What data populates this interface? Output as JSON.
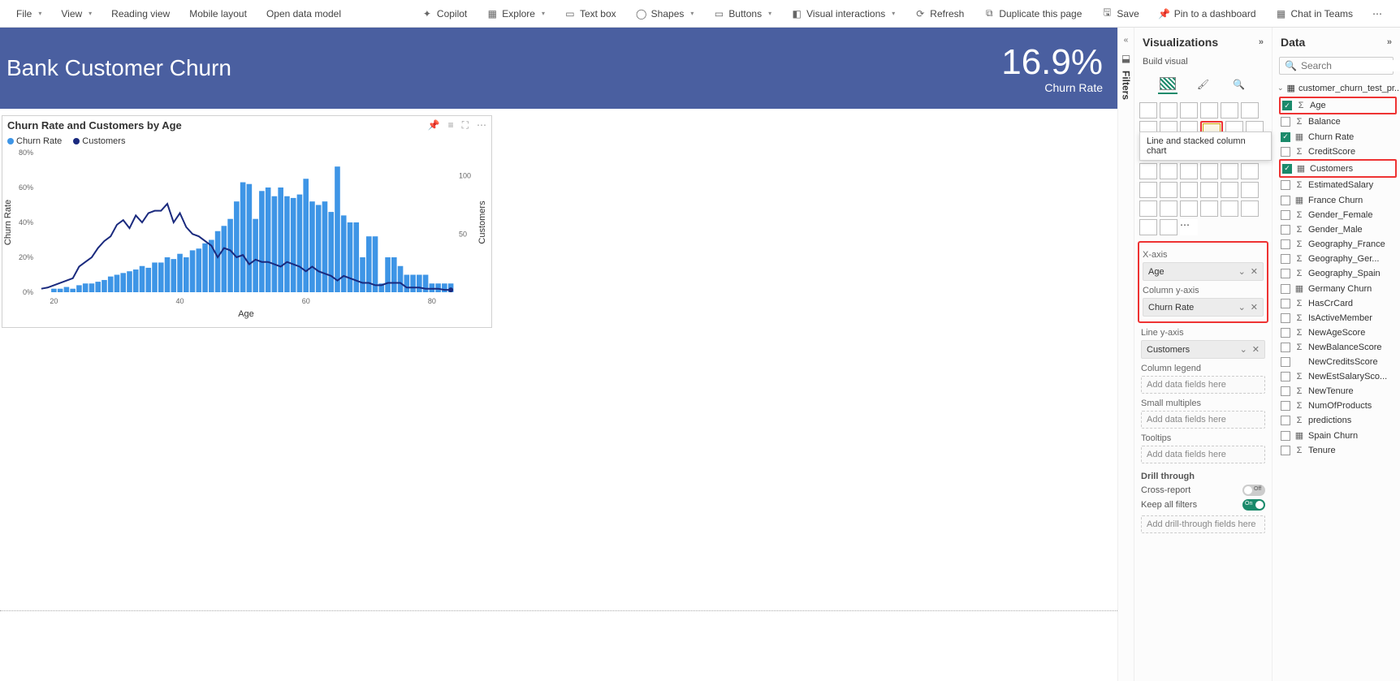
{
  "toolbar": {
    "file": "File",
    "view": "View",
    "reading_view": "Reading view",
    "mobile_layout": "Mobile layout",
    "open_data_model": "Open data model",
    "copilot": "Copilot",
    "explore": "Explore",
    "text_box": "Text box",
    "shapes": "Shapes",
    "buttons": "Buttons",
    "visual_interactions": "Visual interactions",
    "refresh": "Refresh",
    "duplicate": "Duplicate this page",
    "save": "Save",
    "pin": "Pin to a dashboard",
    "chat_teams": "Chat in Teams"
  },
  "banner": {
    "title": "Bank Customer Churn",
    "kpi_value": "16.9%",
    "kpi_label": "Churn Rate"
  },
  "visual": {
    "title": "Churn Rate and Customers by Age",
    "legend_a": "Churn Rate",
    "legend_b": "Customers",
    "xlabel": "Age",
    "ylabel_left": "Churn Rate",
    "ylabel_right": "Customers"
  },
  "filters": {
    "label": "Filters"
  },
  "viz_pane": {
    "title": "Visualizations",
    "subtitle": "Build visual",
    "tooltip": "Line and stacked column chart",
    "wells": {
      "xaxis": "X-axis",
      "xaxis_val": "Age",
      "col_y": "Column y-axis",
      "col_y_val": "Churn Rate",
      "line_y": "Line y-axis",
      "line_y_val": "Customers",
      "col_legend": "Column legend",
      "placeholder": "Add data fields here",
      "small_mult": "Small multiples",
      "tooltips": "Tooltips",
      "drill": "Drill through",
      "cross": "Cross-report",
      "keep_filters": "Keep all filters",
      "off": "Off",
      "on": "On",
      "add_drill": "Add drill-through fields here"
    }
  },
  "data_pane": {
    "title": "Data",
    "search_placeholder": "Search",
    "table": "customer_churn_test_pr...",
    "fields": [
      {
        "name": "Age",
        "checked": true,
        "icon": "Σ",
        "red": true
      },
      {
        "name": "Balance",
        "checked": false,
        "icon": "Σ"
      },
      {
        "name": "Churn Rate",
        "checked": true,
        "icon": "▦"
      },
      {
        "name": "CreditScore",
        "checked": false,
        "icon": "Σ"
      },
      {
        "name": "Customers",
        "checked": true,
        "icon": "▦",
        "red": true
      },
      {
        "name": "EstimatedSalary",
        "checked": false,
        "icon": "Σ"
      },
      {
        "name": "France Churn",
        "checked": false,
        "icon": "▦"
      },
      {
        "name": "Gender_Female",
        "checked": false,
        "icon": "Σ"
      },
      {
        "name": "Gender_Male",
        "checked": false,
        "icon": "Σ"
      },
      {
        "name": "Geography_France",
        "checked": false,
        "icon": "Σ"
      },
      {
        "name": "Geography_Ger...",
        "checked": false,
        "icon": "Σ"
      },
      {
        "name": "Geography_Spain",
        "checked": false,
        "icon": "Σ"
      },
      {
        "name": "Germany Churn",
        "checked": false,
        "icon": "▦"
      },
      {
        "name": "HasCrCard",
        "checked": false,
        "icon": "Σ"
      },
      {
        "name": "IsActiveMember",
        "checked": false,
        "icon": "Σ"
      },
      {
        "name": "NewAgeScore",
        "checked": false,
        "icon": "Σ"
      },
      {
        "name": "NewBalanceScore",
        "checked": false,
        "icon": "Σ"
      },
      {
        "name": "NewCreditsScore",
        "checked": false,
        "icon": ""
      },
      {
        "name": "NewEstSalarySco...",
        "checked": false,
        "icon": "Σ"
      },
      {
        "name": "NewTenure",
        "checked": false,
        "icon": "Σ"
      },
      {
        "name": "NumOfProducts",
        "checked": false,
        "icon": "Σ"
      },
      {
        "name": "predictions",
        "checked": false,
        "icon": "Σ"
      },
      {
        "name": "Spain Churn",
        "checked": false,
        "icon": "▦"
      },
      {
        "name": "Tenure",
        "checked": false,
        "icon": "Σ"
      }
    ]
  },
  "chart_data": {
    "type": "line_stacked_column",
    "xlabel": "Age",
    "ylabel_left": "Churn Rate",
    "ylabel_right": "Customers",
    "x_ticks": [
      20,
      40,
      60,
      80
    ],
    "y_left_ticks": [
      "0%",
      "20%",
      "40%",
      "60%",
      "80%"
    ],
    "y_right_ticks": [
      50,
      100
    ],
    "ages": [
      18,
      19,
      20,
      21,
      22,
      23,
      24,
      25,
      26,
      27,
      28,
      29,
      30,
      31,
      32,
      33,
      34,
      35,
      36,
      37,
      38,
      39,
      40,
      41,
      42,
      43,
      44,
      45,
      46,
      47,
      48,
      49,
      50,
      51,
      52,
      53,
      54,
      55,
      56,
      57,
      58,
      59,
      60,
      61,
      62,
      63,
      64,
      65,
      66,
      67,
      68,
      69,
      70,
      71,
      72,
      73,
      74,
      75,
      76,
      77,
      78,
      79,
      80,
      81,
      82,
      83
    ],
    "columns_churn_rate_pct": [
      0,
      0,
      2,
      2,
      3,
      2,
      4,
      5,
      5,
      6,
      7,
      9,
      10,
      11,
      12,
      13,
      15,
      14,
      17,
      17,
      20,
      19,
      22,
      20,
      24,
      25,
      28,
      30,
      35,
      38,
      42,
      52,
      63,
      62,
      42,
      58,
      60,
      55,
      60,
      55,
      54,
      56,
      65,
      52,
      50,
      52,
      46,
      72,
      44,
      40,
      40,
      20,
      32,
      32,
      5,
      20,
      20,
      15,
      10,
      10,
      10,
      10,
      5,
      5,
      5,
      5
    ],
    "line_customers": [
      3,
      4,
      6,
      8,
      10,
      12,
      22,
      26,
      30,
      38,
      44,
      48,
      58,
      62,
      55,
      66,
      60,
      68,
      70,
      70,
      76,
      60,
      68,
      56,
      50,
      48,
      44,
      40,
      30,
      38,
      36,
      30,
      32,
      24,
      28,
      26,
      26,
      24,
      22,
      26,
      24,
      22,
      18,
      22,
      18,
      16,
      14,
      10,
      14,
      12,
      10,
      8,
      8,
      6,
      6,
      8,
      8,
      8,
      4,
      4,
      4,
      3,
      3,
      3,
      2,
      2
    ]
  }
}
